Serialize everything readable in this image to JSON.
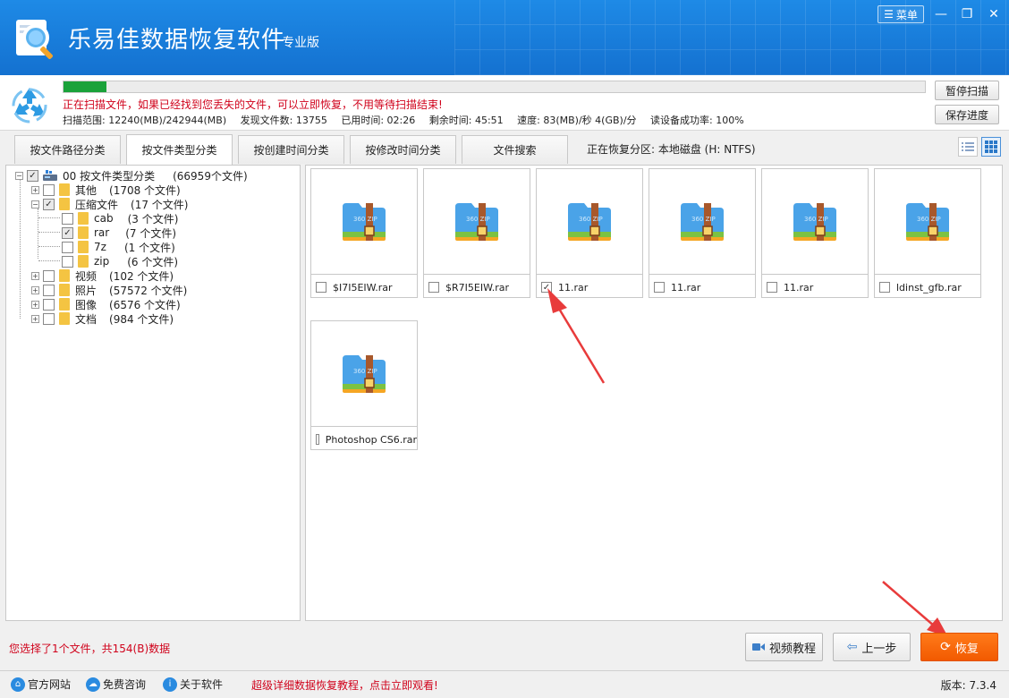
{
  "app": {
    "title": "乐易佳数据恢复软件",
    "edition": "专业版",
    "menu_label": "菜单",
    "accent": "#1677d6"
  },
  "scan": {
    "progress_fraction": 0.05,
    "message": "正在扫描文件，如果已经找到您丢失的文件，可以立即恢复，不用等待扫描结束!",
    "range": "扫描范围: 12240(MB)/242944(MB)",
    "found": "发现文件数: 13755",
    "elapsed": "已用时间: 02:26",
    "remaining": "剩余时间: 45:51",
    "speed": "速度: 83(MB)/秒  4(GB)/分",
    "read_rate": "读设备成功率: 100%",
    "pause_label": "暂停扫描",
    "save_label": "保存进度"
  },
  "tabs": [
    {
      "label": "按文件路径分类",
      "active": false
    },
    {
      "label": "按文件类型分类",
      "active": true
    },
    {
      "label": "按创建时间分类",
      "active": false
    },
    {
      "label": "按修改时间分类",
      "active": false
    },
    {
      "label": "文件搜索",
      "active": false
    }
  ],
  "partition": "正在恢复分区: 本地磁盘 (H: NTFS)",
  "tree": {
    "root": {
      "label": "00  按文件类型分类",
      "count": "(66959个文件)"
    },
    "items": [
      {
        "label": "其他",
        "count": "(1708 个文件)"
      },
      {
        "label": "压缩文件",
        "count": "(17 个文件)"
      },
      {
        "label": "cab",
        "count": "(3 个文件)"
      },
      {
        "label": "rar",
        "count": "(7 个文件)"
      },
      {
        "label": "7z",
        "count": "(1 个文件)"
      },
      {
        "label": "zip",
        "count": "(6 个文件)"
      },
      {
        "label": "视频",
        "count": "(102 个文件)"
      },
      {
        "label": "照片",
        "count": "(57572 个文件)"
      },
      {
        "label": "图像",
        "count": "(6576 个文件)"
      },
      {
        "label": "文档",
        "count": "(984 个文件)"
      }
    ]
  },
  "files": [
    {
      "name": "$I7I5EIW.rar",
      "checked": false
    },
    {
      "name": "$R7I5EIW.rar",
      "checked": false
    },
    {
      "name": "11.rar",
      "checked": true
    },
    {
      "name": "11.rar",
      "checked": false
    },
    {
      "name": "11.rar",
      "checked": false
    },
    {
      "name": "ldinst_gfb.rar",
      "checked": false
    },
    {
      "name": "Photoshop CS6.rar",
      "checked": false
    }
  ],
  "zip_icon_text": "360 ZIP",
  "selection_info": "您选择了1个文件，共154(B)数据",
  "buttons": {
    "video_tutorial": "视频教程",
    "prev_step": "上一步",
    "recover": "恢复"
  },
  "footer": {
    "official_site": "官方网站",
    "free_consult": "免费咨询",
    "about": "关于软件",
    "tutorial_promo": "超级详细数据恢复教程，点击立即观看!",
    "version": "版本: 7.3.4"
  }
}
